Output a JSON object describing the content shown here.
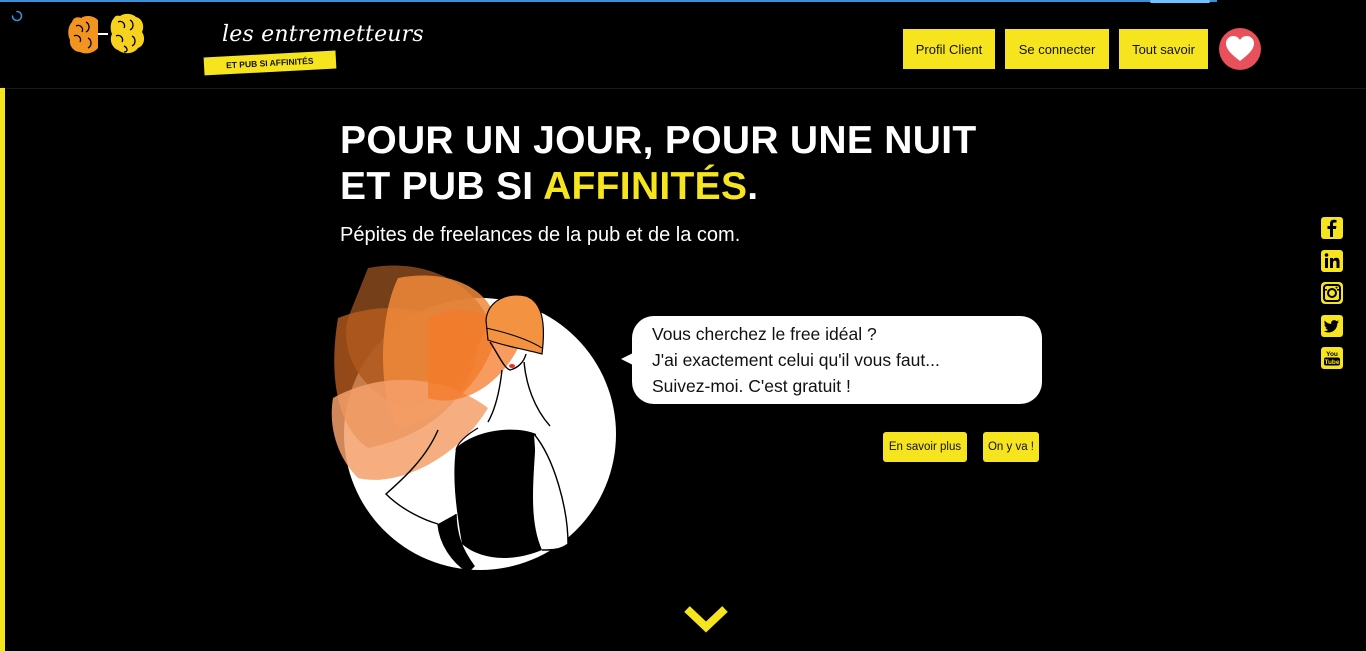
{
  "brand": {
    "name": "les entremetteurs",
    "tagline": "ET PUB SI AFFINITÉS",
    "accent_color": "#f6e51e",
    "brain_colors": [
      "#f39320",
      "#f6d21e"
    ]
  },
  "nav": {
    "items": [
      {
        "label": "Profil Client"
      },
      {
        "label": "Se connecter"
      },
      {
        "label": "Tout savoir"
      }
    ],
    "favorite_icon": "heart-icon",
    "favorite_color": "#e8505b"
  },
  "hero": {
    "line1": "POUR UN JOUR, POUR UNE NUIT",
    "line2_prefix": "ET PUB SI ",
    "line2_accent": "AFFINITÉS",
    "line2_suffix": ".",
    "subtitle": "Pépites de freelances de la pub et de la com."
  },
  "speech": {
    "lines": [
      "Vous cherchez le free idéal ?",
      "J'ai exactement celui qu'il vous faut...",
      "Suivez-moi. C'est gratuit !"
    ]
  },
  "cta": {
    "learn_more": "En savoir plus",
    "go": "On y va !"
  },
  "social": [
    {
      "icon": "facebook-icon",
      "letters": "f"
    },
    {
      "icon": "linkedin-icon",
      "letters": "in"
    },
    {
      "icon": "instagram-icon",
      "letters": ""
    },
    {
      "icon": "twitter-icon",
      "letters": ""
    },
    {
      "icon": "youtube-icon",
      "letters": "You Tube"
    }
  ],
  "scroll": {
    "icon": "chevron-down-icon"
  }
}
